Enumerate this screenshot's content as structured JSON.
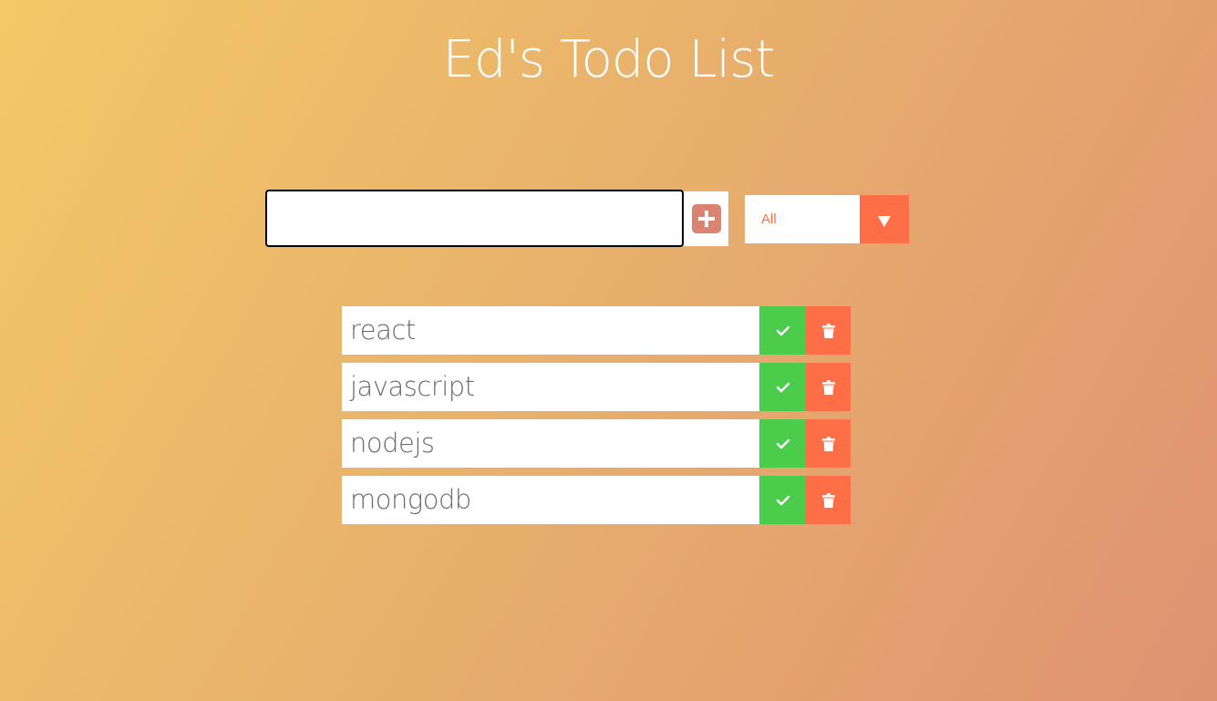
{
  "app": {
    "title": "Ed's Todo List"
  },
  "form": {
    "input_value": "",
    "input_placeholder": "",
    "add_icon": "plus-square-icon",
    "filter": {
      "selected": "All",
      "arrow_icon": "triangle-down-icon"
    }
  },
  "todos": [
    {
      "text": "react"
    },
    {
      "text": "javascript"
    },
    {
      "text": "nodejs"
    },
    {
      "text": "mongodb"
    }
  ],
  "colors": {
    "accent": "#ff6f47",
    "complete": "#4bcc4b",
    "add_icon": "#d98370",
    "gradient_start": "#f3c967",
    "gradient_end": "#df9272"
  },
  "icons": {
    "complete": "check-icon",
    "delete": "trash-icon"
  }
}
